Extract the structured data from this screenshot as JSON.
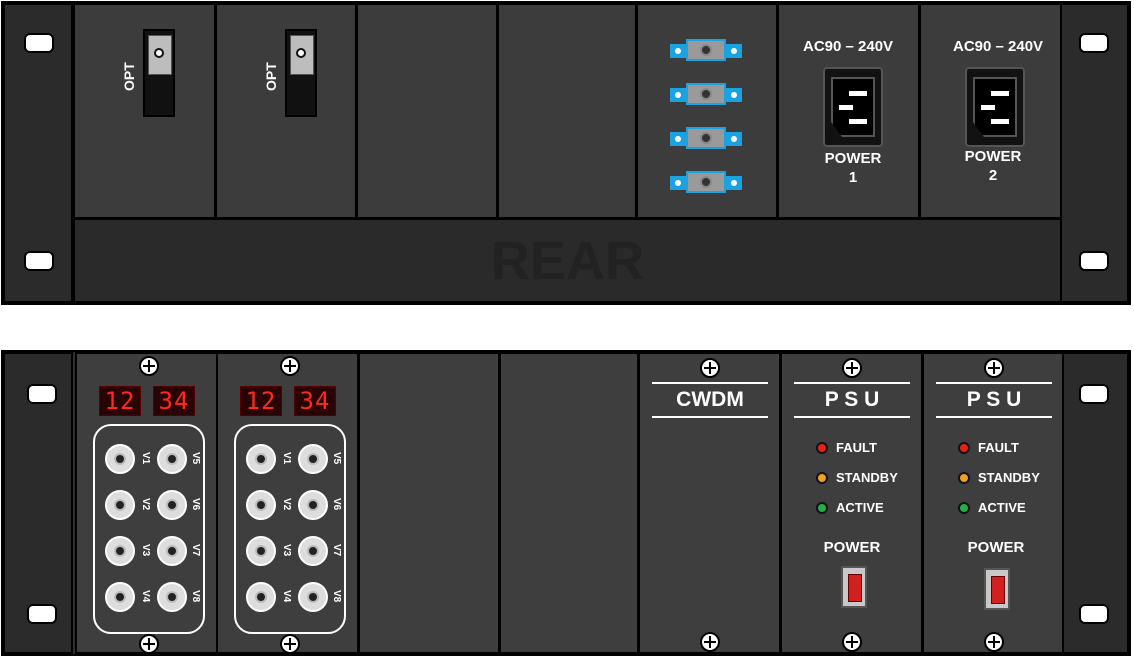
{
  "rear": {
    "label": "REAR",
    "opt_label": "OPT",
    "ac_rating": "AC90 – 240V",
    "power_label": "POWER",
    "power1_num": "1",
    "power2_num": "2"
  },
  "front": {
    "digits_left": "12",
    "digits_right": "34",
    "video_channels": [
      "V1",
      "V2",
      "V3",
      "V4",
      "V5",
      "V6",
      "V7",
      "V8"
    ],
    "cwdm_title": "CWDM",
    "psu_title": "P S U",
    "led_fault": "FAULT",
    "led_standby": "STANDBY",
    "led_active": "ACTIVE",
    "power_label": "POWER"
  },
  "colors": {
    "led_fault": "#e8201a",
    "led_standby": "#f0a020",
    "led_active": "#20b050",
    "fiber_accent": "#1aa3e0",
    "digit_red": "#ff2a1a"
  }
}
